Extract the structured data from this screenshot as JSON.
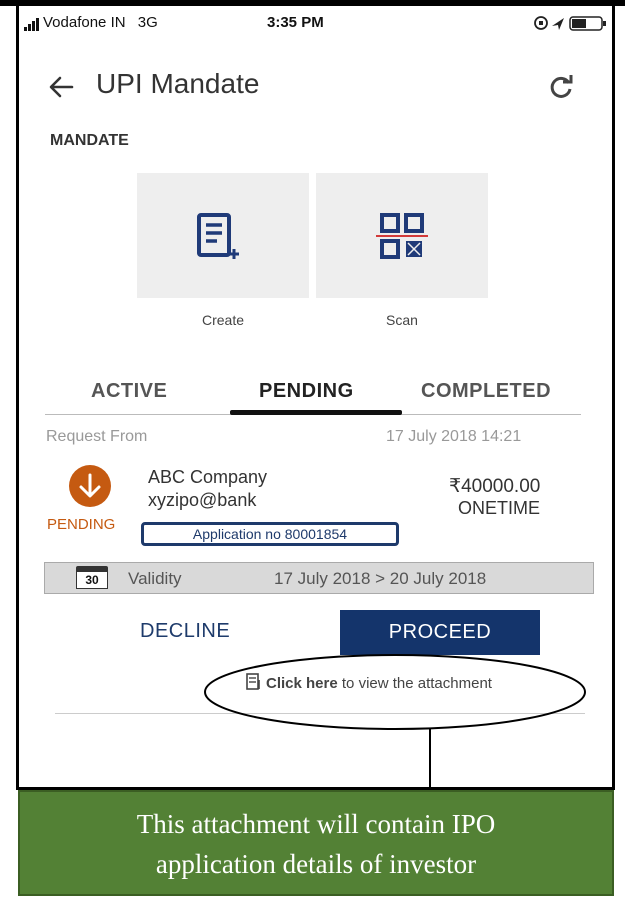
{
  "status_bar": {
    "carrier": "Vodafone IN",
    "network": "3G",
    "time": "3:35 PM"
  },
  "header": {
    "title": "UPI Mandate",
    "back_icon": "arrow-left-icon",
    "refresh_icon": "refresh-icon"
  },
  "section_label": "MANDATE",
  "actions": [
    {
      "label": "Create",
      "icon": "document-add-icon"
    },
    {
      "label": "Scan",
      "icon": "qr-scan-icon"
    }
  ],
  "tabs": [
    {
      "label": "ACTIVE",
      "selected": false
    },
    {
      "label": "PENDING",
      "selected": true
    },
    {
      "label": "COMPLETED",
      "selected": false
    }
  ],
  "request": {
    "from_label": "Request From",
    "datetime": "17 July 2018 14:21",
    "payee_name": "ABC Company",
    "payee_vpa": "xyzipo@bank",
    "amount": "₹40000.00",
    "frequency": "ONETIME",
    "status": "PENDING",
    "application": "Application no 80001854",
    "calendar_day": "30",
    "validity_label": "Validity",
    "validity_range": "17 July 2018 > 20 July 2018"
  },
  "buttons": {
    "decline": "DECLINE",
    "proceed": "PROCEED"
  },
  "attachment": {
    "link_bold": "Click here",
    "link_rest": " to view the attachment"
  },
  "annotation": {
    "line1": "This attachment will contain IPO",
    "line2": "application details of investor"
  },
  "colors": {
    "primary": "#14346b",
    "pending": "#c55a11",
    "annotation_bg": "#538135",
    "tab_indicator": "#111111"
  }
}
